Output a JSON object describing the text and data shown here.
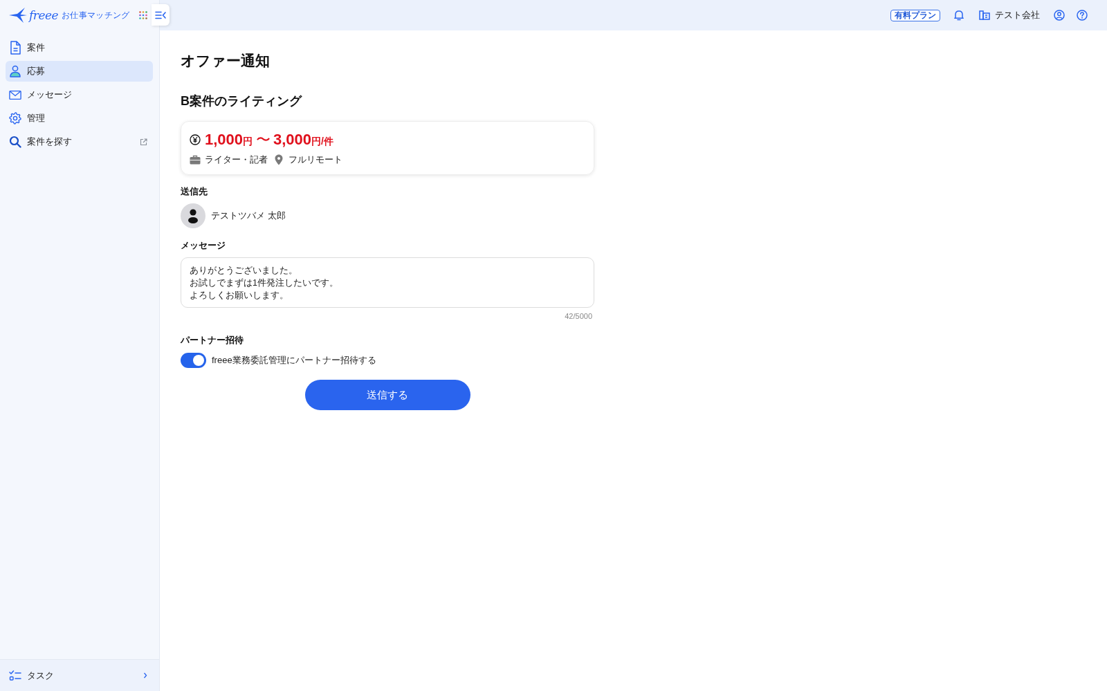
{
  "sidebar": {
    "logo": {
      "brand": "freee",
      "product": "お仕事マッチング"
    },
    "items": [
      {
        "label": "案件",
        "selected": false,
        "external": false
      },
      {
        "label": "応募",
        "selected": true,
        "external": false
      },
      {
        "label": "メッセージ",
        "selected": false,
        "external": false
      },
      {
        "label": "管理",
        "selected": false,
        "external": false
      },
      {
        "label": "案件を探す",
        "selected": false,
        "external": true
      }
    ],
    "footer_item": {
      "label": "タスク"
    }
  },
  "header": {
    "plan_badge": "有料プラン",
    "company": "テスト会社"
  },
  "page": {
    "title": "オファー通知"
  },
  "job": {
    "title": "B案件のライティング",
    "price": {
      "min": "1,000",
      "min_unit": "円",
      "separator": "〜",
      "max": "3,000",
      "max_unit": "円/件"
    },
    "category": "ライター・記者",
    "location": "フルリモート"
  },
  "recipient": {
    "label": "送信先",
    "name": "テストツバメ 太郎"
  },
  "message": {
    "label": "メッセージ",
    "lines": [
      "ありがとうございました。",
      "お試しでまずは1件発注したいです。",
      "よろしくお願いします。"
    ],
    "counter": "42/5000"
  },
  "partner_invite": {
    "label": "パートナー招待",
    "toggle_label": "freee業務委託管理にパートナー招待する",
    "on": true
  },
  "submit_button": {
    "label": "送信する"
  }
}
